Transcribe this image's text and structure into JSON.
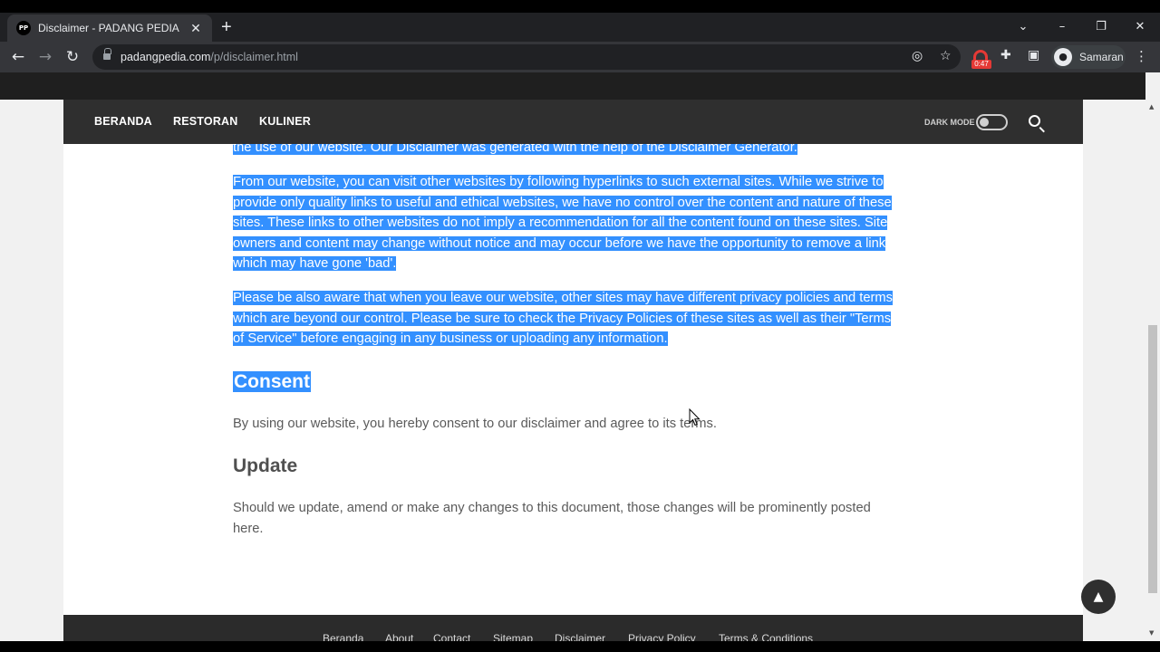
{
  "browser": {
    "tab_title": "Disclaimer - PADANG PEDIA",
    "favicon_text": "PP",
    "url_domain": "padangpedia.com",
    "url_path": "/p/disclaimer.html",
    "extension_timer": "0:47",
    "profile_name": "Samaran"
  },
  "nav": {
    "links": [
      "BERANDA",
      "RESTORAN",
      "KULINER"
    ],
    "dark_mode_label": "DARK MODE"
  },
  "article": {
    "partial_line": "the use of our website. Our Disclaimer was generated with the help of the Disclaimer Generator.",
    "paragraph_external_links": [
      "From our website, you can visit other websites by following hyperlinks to such external sites. While we strive to",
      "provide only quality links to useful and ethical websites, we have no control over the content and nature of these",
      "sites. These links to other websites do not imply a recommendation for all the content found on these sites. Site",
      "owners and content may change without notice and may occur before we have the opportunity to remove a link",
      "which may have gone 'bad'."
    ],
    "paragraph_privacy": [
      "Please be also aware that when you leave our website, other sites may have different privacy policies and terms",
      "which are beyond our control. Please be sure to check the Privacy Policies of these sites as well as their \"Terms",
      "of Service\" before engaging in any business or uploading any information."
    ],
    "heading_consent": "Consent",
    "consent_text": "By using our website, you hereby consent to our disclaimer and agree to its terms.",
    "heading_update": "Update",
    "update_text": [
      "Should we update, amend or make any changes to this document, those changes will be prominently posted",
      "here."
    ]
  },
  "footer": {
    "links": [
      "Beranda",
      "About",
      "Contact",
      "Sitemap",
      "Disclaimer",
      "Privacy Policy",
      "Terms & Conditions"
    ]
  },
  "colors": {
    "selection": "#3390ff",
    "navbar": "#2f2f2f",
    "text": "#5a5a5a"
  }
}
